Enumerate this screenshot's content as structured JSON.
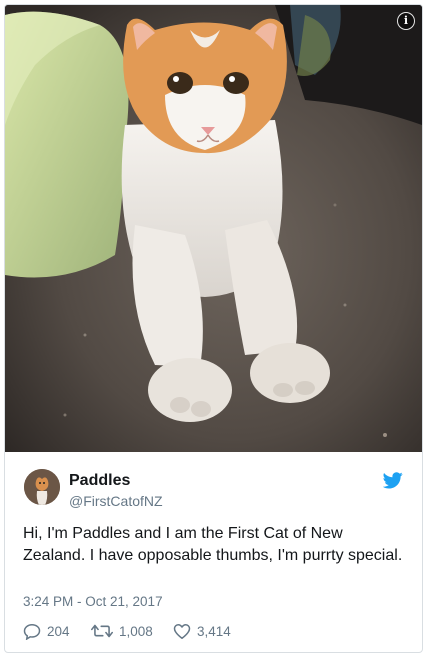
{
  "tweet": {
    "author_name": "Paddles",
    "author_handle": "@FirstCatofNZ",
    "text": "Hi, I'm Paddles and I am the First Cat of New Zealand. I have opposable thumbs, I'm purrty special.",
    "timestamp": "3:24 PM - Oct 21, 2017",
    "info_glyph": "i",
    "stats": {
      "replies": "204",
      "retweets": "1,008",
      "likes": "3,414"
    }
  },
  "colors": {
    "text": "#14171a",
    "muted": "#657786",
    "twitter_blue": "#1da1f2",
    "border": "#d9dee2"
  },
  "icons": [
    "info-icon",
    "twitter-bird-icon",
    "reply-icon",
    "retweet-icon",
    "like-icon"
  ]
}
